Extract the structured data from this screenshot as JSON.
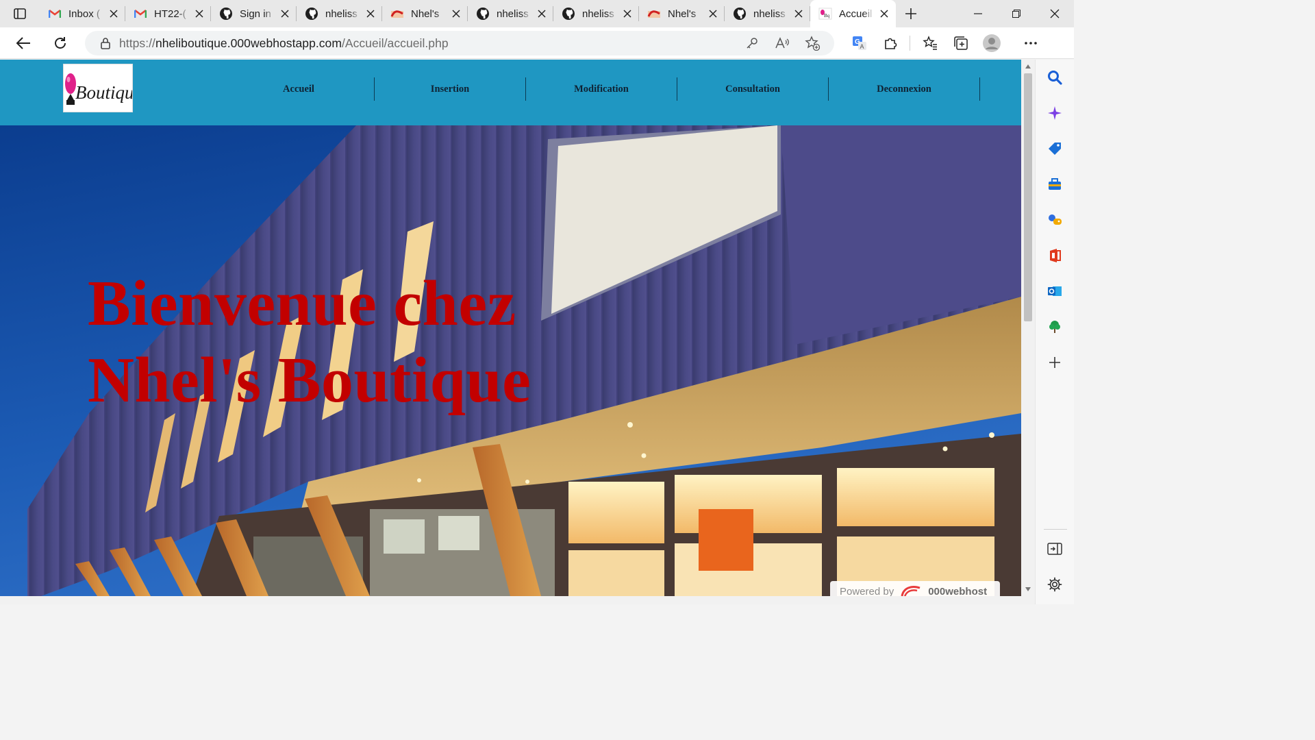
{
  "browser": {
    "tabs": [
      {
        "title": "Inbox (",
        "icon": "gmail-icon"
      },
      {
        "title": "HT22-(",
        "icon": "gmail-icon"
      },
      {
        "title": "Sign in",
        "icon": "github-icon"
      },
      {
        "title": "nheliss",
        "icon": "github-icon"
      },
      {
        "title": "Nhel's",
        "icon": "boutique-icon"
      },
      {
        "title": "nheliss",
        "icon": "github-icon"
      },
      {
        "title": "nheliss",
        "icon": "github-icon"
      },
      {
        "title": "Nhel's",
        "icon": "boutique-icon"
      },
      {
        "title": "nheliss",
        "icon": "github-icon"
      },
      {
        "title": "Accueil",
        "icon": "boutique-icon",
        "active": true
      }
    ],
    "address": {
      "scheme": "https://",
      "host": "nheliboutique.000webhostapp.com",
      "path": "/Accueil/accueil.php"
    },
    "colors": {
      "accent_blue": "#1f97c2",
      "title_red": "#c20000"
    }
  },
  "site": {
    "logo_text": "Boutique",
    "nav": [
      "Accueil",
      "Insertion",
      "Modification",
      "Consultation",
      "Deconnexion"
    ],
    "hero_line1": "Bienvenue chez",
    "hero_line2": "Nhel's Boutique",
    "powered_by": "Powered by",
    "powered_brand": "000webhost"
  }
}
